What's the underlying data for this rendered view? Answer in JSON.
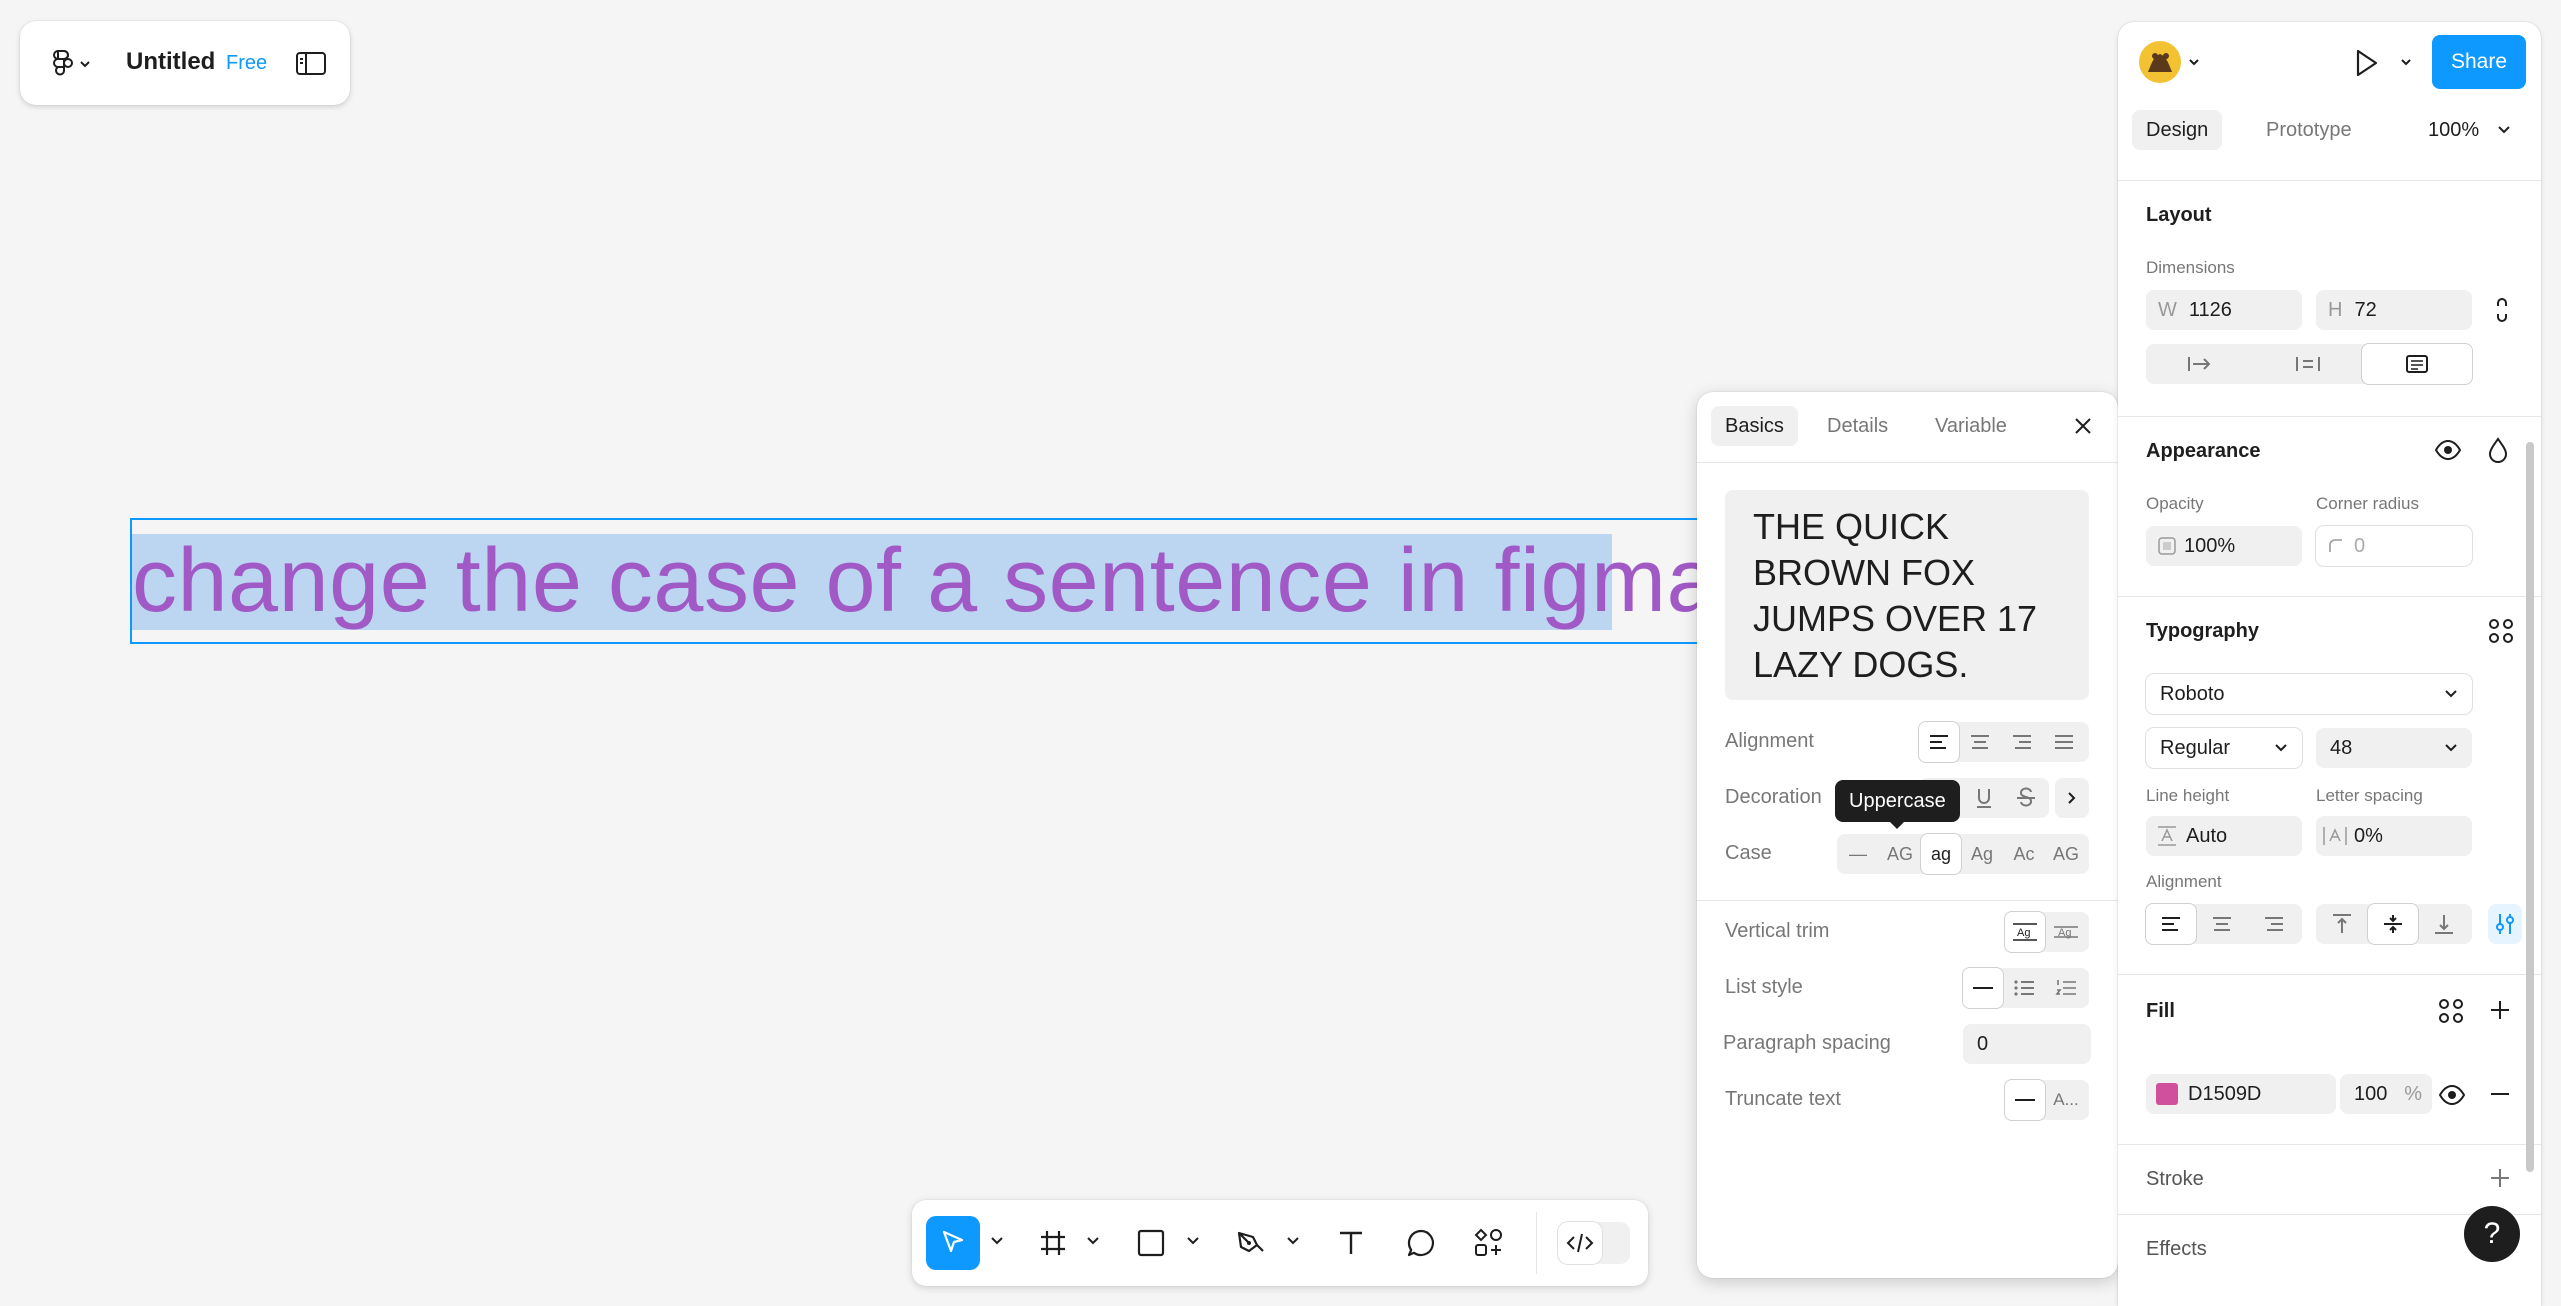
{
  "file": {
    "title": "Untitled",
    "plan": "Free"
  },
  "canvas": {
    "text": "change the case of a sentence in figma."
  },
  "popover": {
    "tabs": [
      "Basics",
      "Details",
      "Variable"
    ],
    "preview": "THE QUICK BROWN FOX JUMPS OVER 17 LAZY DOGS.",
    "alignment_label": "Alignment",
    "decoration_label": "Decoration",
    "case_label": "Case",
    "case_options": [
      "—",
      "AG",
      "ag",
      "Ag",
      "Ac",
      "AG"
    ],
    "tooltip": "Uppercase",
    "vertical_trim_label": "Vertical trim",
    "list_style_label": "List style",
    "paragraph_spacing_label": "Paragraph spacing",
    "paragraph_spacing_value": "0",
    "truncate_label": "Truncate text",
    "truncate_option": "A..."
  },
  "right_panel": {
    "share": "Share",
    "tabs": [
      "Design",
      "Prototype"
    ],
    "zoom": "100%",
    "layout": {
      "title": "Layout",
      "dimensions_label": "Dimensions",
      "w_prefix": "W",
      "w": "1126",
      "h_prefix": "H",
      "h": "72"
    },
    "appearance": {
      "title": "Appearance",
      "opacity_label": "Opacity",
      "opacity": "100%",
      "radius_label": "Corner radius",
      "radius": "0"
    },
    "typography": {
      "title": "Typography",
      "font": "Roboto",
      "weight": "Regular",
      "size": "48",
      "line_height_label": "Line height",
      "line_height": "Auto",
      "letter_spacing_label": "Letter spacing",
      "letter_spacing": "0%",
      "alignment_label": "Alignment"
    },
    "fill": {
      "title": "Fill",
      "hex": "D1509D",
      "opacity": "100",
      "unit": "%",
      "color": "#D1509D"
    },
    "stroke": {
      "title": "Stroke"
    },
    "effects": {
      "title": "Effects"
    }
  },
  "help": "?"
}
